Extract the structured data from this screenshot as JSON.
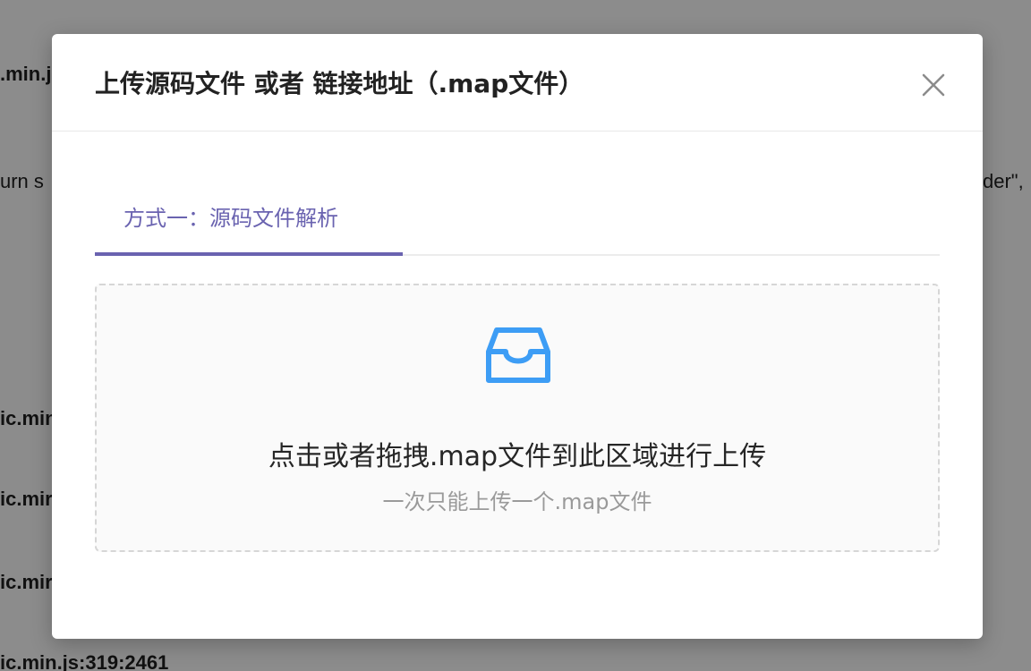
{
  "background": {
    "fragments": [
      ".min.j",
      "urn s",
      "der\",",
      "ic.min",
      "ic.mir",
      "ic.mir",
      "ic.min.js:319:2461"
    ]
  },
  "modal": {
    "title": "上传源码文件 或者 链接地址（.map文件）",
    "close_icon": "close-icon",
    "tabs": [
      {
        "label": "方式一：源码文件解析",
        "active": true
      }
    ],
    "dropzone": {
      "icon": "inbox-icon",
      "text": "点击或者拖拽.map文件到此区域进行上传",
      "hint": "一次只能上传一个.map文件"
    }
  },
  "colors": {
    "accent": "#6a63b0",
    "icon_blue": "#3d9df5",
    "overlay": "rgba(0,0,0,0.45)"
  }
}
